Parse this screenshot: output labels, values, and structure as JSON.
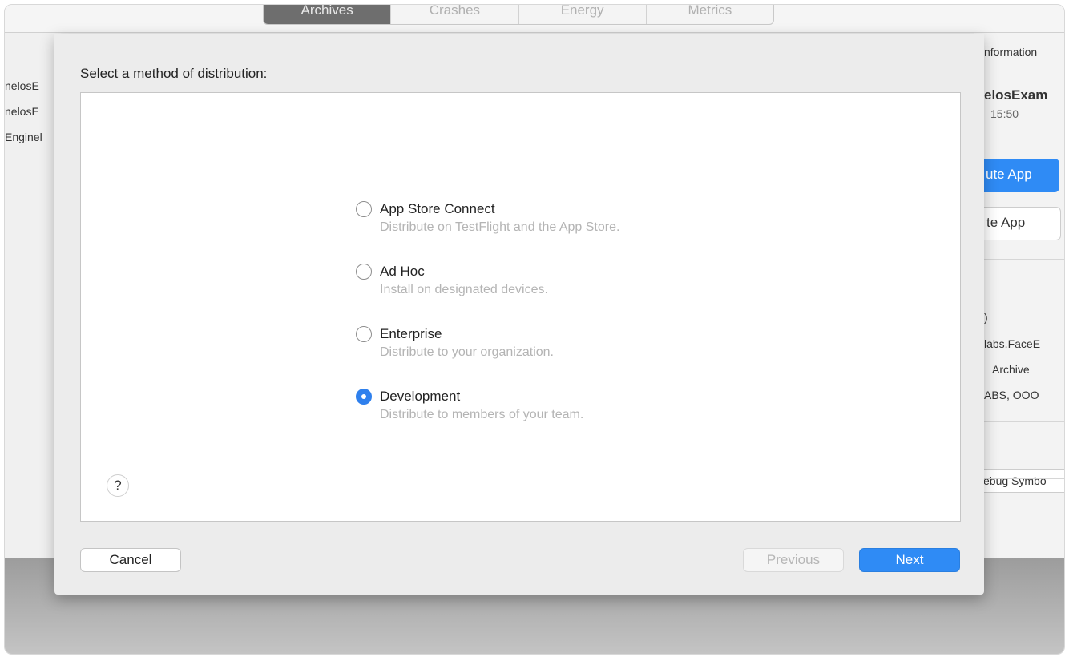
{
  "tabs": [
    "Archives",
    "Crashes",
    "Energy",
    "Metrics"
  ],
  "background": {
    "left_items": [
      "nelosE",
      "nelosE",
      "Enginel"
    ],
    "right": {
      "header": "nformation",
      "app_name": "elosExam",
      "time": "15:50",
      "primary_button": "ute App",
      "secondary_button": "te App",
      "lines": [
        ")",
        "labs.FaceE",
        "Archive",
        "ABS, OOO"
      ],
      "symbols_button": "ebug Symbo"
    }
  },
  "dialog": {
    "title": "Select a method of distribution:",
    "options": [
      {
        "label": "App Store Connect",
        "description": "Distribute on TestFlight and the App Store.",
        "selected": false
      },
      {
        "label": "Ad Hoc",
        "description": "Install on designated devices.",
        "selected": false
      },
      {
        "label": "Enterprise",
        "description": "Distribute to your organization.",
        "selected": false
      },
      {
        "label": "Development",
        "description": "Distribute to members of your team.",
        "selected": true
      }
    ],
    "help_label": "?",
    "cancel_label": "Cancel",
    "previous_label": "Previous",
    "next_label": "Next"
  },
  "colors": {
    "accent": "#2f8bf5",
    "radio_checked": "#2f80ed",
    "description_text": "#b4b4b4"
  }
}
